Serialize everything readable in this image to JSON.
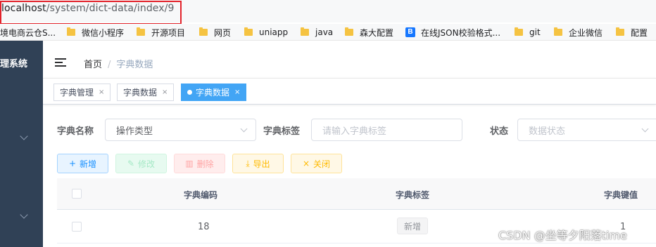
{
  "browser": {
    "url_host": "localhost",
    "url_path": "/system/dict-data/index/9",
    "highlight_color": "#e2232b"
  },
  "bookmarks": [
    {
      "label": "境电商云仓S...",
      "icon": "doc-icon"
    },
    {
      "label": "微信小程序",
      "icon": "folder-icon"
    },
    {
      "label": "开源项目",
      "icon": "folder-icon"
    },
    {
      "label": "网页",
      "icon": "folder-icon"
    },
    {
      "label": "uniapp",
      "icon": "folder-icon"
    },
    {
      "label": "java",
      "icon": "folder-icon"
    },
    {
      "label": "森大配置",
      "icon": "folder-icon"
    },
    {
      "label": "在线JSON校验格式...",
      "icon": "json-b-icon"
    },
    {
      "label": "git",
      "icon": "folder-icon"
    },
    {
      "label": "企业微信",
      "icon": "folder-icon"
    },
    {
      "label": "配置",
      "icon": "folder-icon"
    }
  ],
  "sidebar": {
    "title": "理系统",
    "bg_color": "#304156"
  },
  "header": {
    "breadcrumb_home": "首页",
    "breadcrumb_sep": "/",
    "breadcrumb_current": "字典数据"
  },
  "tabs": [
    {
      "label": "字典管理",
      "close": "×",
      "active": false
    },
    {
      "label": "字典数据",
      "close": "×",
      "active": false
    },
    {
      "label": "字典数据",
      "close": "×",
      "active": true
    }
  ],
  "search": {
    "dict_name_label": "字典名称",
    "dict_name_value": "操作类型",
    "dict_label_label": "字典标签",
    "dict_label_placeholder": "请输入字典标签",
    "status_label": "状态",
    "status_placeholder": "数据状态"
  },
  "toolbar": {
    "add": "新增",
    "edit": "修改",
    "delete": "删除",
    "export": "导出",
    "close": "关闭"
  },
  "table": {
    "columns": [
      "字典编码",
      "字典标签",
      "字典键值"
    ],
    "rows": [
      {
        "code": "18",
        "label": "新增",
        "value": "1"
      }
    ]
  },
  "watermark": "CSDN @坐等夕阳落time",
  "colors": {
    "primary": "#1890ff",
    "active_tab": "#42a5f5"
  }
}
